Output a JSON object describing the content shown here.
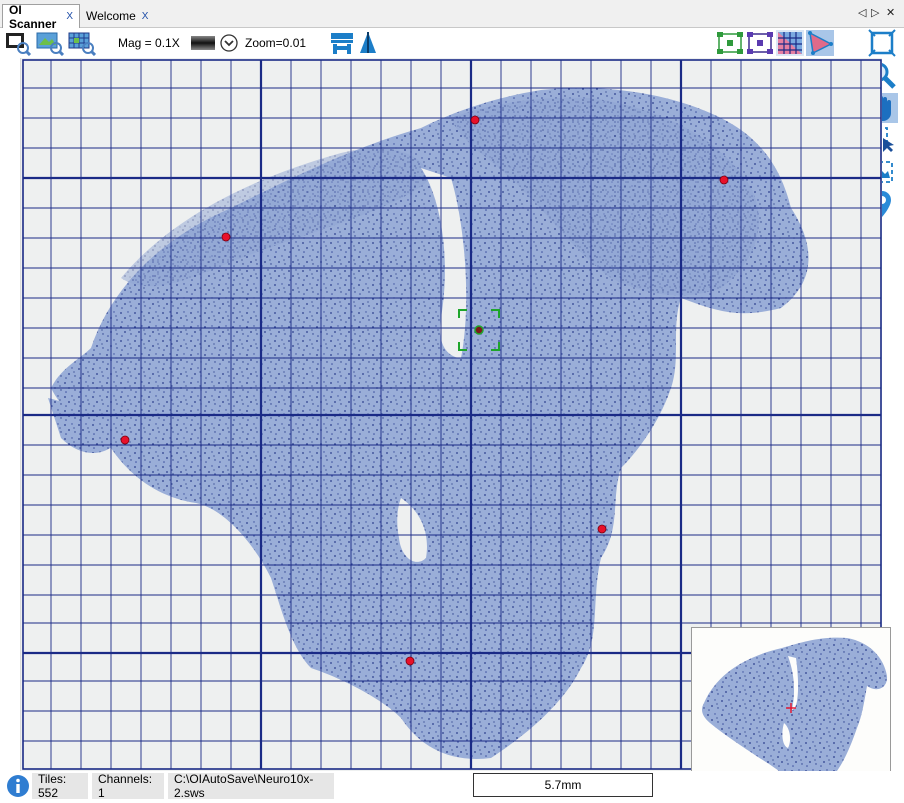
{
  "tabs": [
    {
      "label": "OI Scanner",
      "close": "X",
      "active": true
    },
    {
      "label": "Welcome",
      "close": "X",
      "active": false
    }
  ],
  "tab_controls": {
    "prev": "◁",
    "next": "▷",
    "close": "✕"
  },
  "toolbar": {
    "mag_label": "Mag = 0.1X",
    "zoom_label": "Zoom=0.01",
    "tools_left": [
      "scan-overview-icon",
      "scan-image-icon",
      "scan-grid-icon"
    ],
    "tools_right": [
      "grid-select-green-icon",
      "grid-select-purple-icon",
      "grid-fill-icon",
      "region-triangle-icon"
    ]
  },
  "right_tools": [
    {
      "name": "fit-frame-icon",
      "selected": false
    },
    {
      "name": "zoom-magnifier-icon",
      "selected": false
    },
    {
      "name": "pan-hand-icon",
      "selected": true
    },
    {
      "name": "select-region-icon",
      "selected": false
    },
    {
      "name": "focus-region-icon",
      "selected": false
    },
    {
      "name": "location-pin-icon",
      "selected": false
    }
  ],
  "colors": {
    "grid_line": "#1a2a86",
    "tissue": "#97a9d2",
    "tissue_dark": "#2c3f8e",
    "focus_point": "#e8102a",
    "crosshair": "#1ea52b",
    "selected_tool": "#a9c6e8"
  },
  "scan": {
    "focus_points": 7,
    "crosshair_present": true
  },
  "status": {
    "info_icon": "info-icon",
    "tiles": "Tiles: 552",
    "channels": "Channels: 1",
    "file_path": "C:\\OIAutoSave\\Neuro10x-2.sws",
    "scale_bar": "5.7mm"
  },
  "overview": {
    "marker": "red-cross-marker"
  }
}
